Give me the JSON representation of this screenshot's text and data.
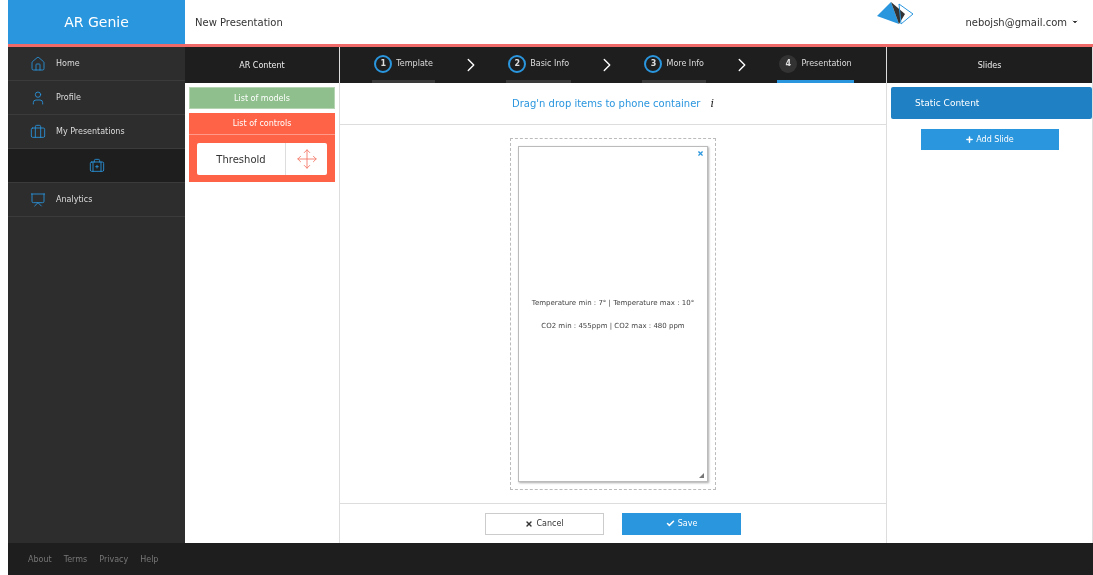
{
  "app": {
    "title": "AR Genie"
  },
  "header": {
    "page_title": "New Presentation",
    "user": "nebojsh@gmail.com"
  },
  "sidebar": {
    "items": [
      {
        "label": "Home",
        "kind": "home"
      },
      {
        "label": "Profile",
        "kind": "profile"
      },
      {
        "label": "My Presentations",
        "kind": "presentations"
      },
      {
        "kind": "add"
      },
      {
        "label": "Analytics",
        "kind": "analytics"
      }
    ]
  },
  "content_panel": {
    "title": "AR Content",
    "models_label": "List of models",
    "controls_label": "List of controls",
    "controls": [
      {
        "label": "Threshold"
      }
    ]
  },
  "steps": [
    {
      "number": "1",
      "label": "Template",
      "selected": false
    },
    {
      "number": "2",
      "label": "Basic Info",
      "selected": false
    },
    {
      "number": "3",
      "label": "More Info",
      "selected": false
    },
    {
      "number": "4",
      "label": "Presentation",
      "selected": true
    }
  ],
  "editor": {
    "hint": "Drag'n drop items to phone container",
    "info": "i",
    "lines": [
      "Temperature min : 7° | Temperature max : 10°",
      "CO2 min : 455ppm | CO2 max : 480 ppm"
    ]
  },
  "buttons": {
    "cancel": "Cancel",
    "save": "Save"
  },
  "slides": {
    "title": "Slides",
    "items": [
      {
        "label": "Static Content"
      }
    ],
    "add_button": "Add Slide"
  },
  "footer": {
    "links": [
      "About",
      "Terms",
      "Privacy",
      "Help"
    ]
  }
}
